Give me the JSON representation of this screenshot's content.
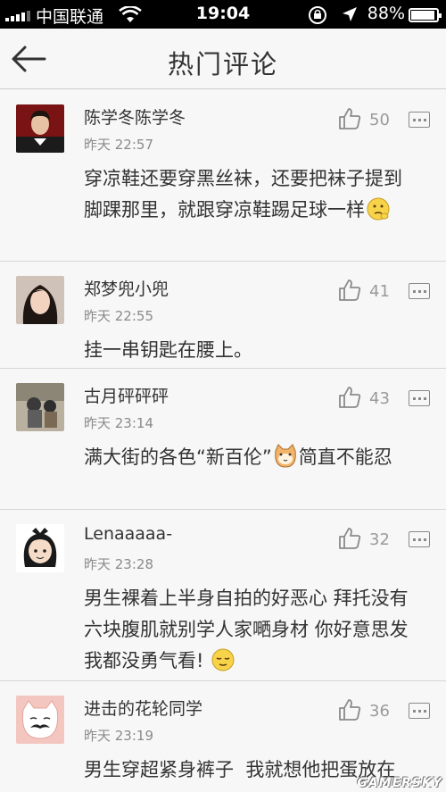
{
  "status_bar": {
    "carrier": "中国联通",
    "time": "19:04",
    "battery": "88%",
    "battery_level": 0.88
  },
  "header": {
    "title": "热门评论",
    "back_icon": "back-arrow-icon"
  },
  "comments": [
    {
      "user": "陈学冬陈学冬",
      "time": "昨天 22:57",
      "likes": "50",
      "text": "穿凉鞋还要穿黑丝袜，还要把袜子提到脚踝那里，就跟穿凉鞋踢足球一样",
      "emoji": "thinking-emoji-icon"
    },
    {
      "user": "郑梦兜小兜",
      "time": "昨天 22:55",
      "likes": "41",
      "text": "挂一串钥匙在腰上。"
    },
    {
      "user": "古月砰砰砰",
      "time": "昨天 23:14",
      "likes": "43",
      "text_before": "满大街的各色“新百伦”",
      "text_after": "简直不能忍",
      "emoji": "cat-face-emoji-icon"
    },
    {
      "user": "Lenaaaaa-",
      "time": "昨天 23:28",
      "likes": "32",
      "text": "男生裸着上半身自拍的好恶心 拜托没有六块腹肌就别学人家嗮身材 你好意思发 我都没勇气看!",
      "emoji": "relieved-emoji-icon"
    },
    {
      "user": "进击的花轮同学",
      "time": "昨天 23:19",
      "likes": "36",
      "text": "男生穿超紧身裤子  我就想他把蛋放在哪里了"
    }
  ],
  "watermark": "GAMERSKY",
  "colors": {
    "background": "#f7f7f7",
    "text": "#333333",
    "muted": "#8a8a8a",
    "status_bar": "#000000"
  }
}
